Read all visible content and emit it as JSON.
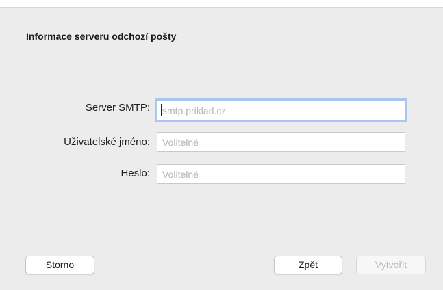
{
  "dialog": {
    "title": "Informace serveru odchozí pošty"
  },
  "form": {
    "smtp_server": {
      "label": "Server SMTP:",
      "value": "",
      "placeholder": "smtp.priklad.cz"
    },
    "username": {
      "label": "Uživatelské jméno:",
      "value": "",
      "placeholder": "Volitelné"
    },
    "password": {
      "label": "Heslo:",
      "value": "",
      "placeholder": "Volitelné"
    }
  },
  "buttons": {
    "cancel": "Storno",
    "back": "Zpět",
    "create": "Vytvořit"
  },
  "colors": {
    "background": "#ececec",
    "focus_ring": "#a9c6f2",
    "disabled_text": "#b9b9b9"
  }
}
